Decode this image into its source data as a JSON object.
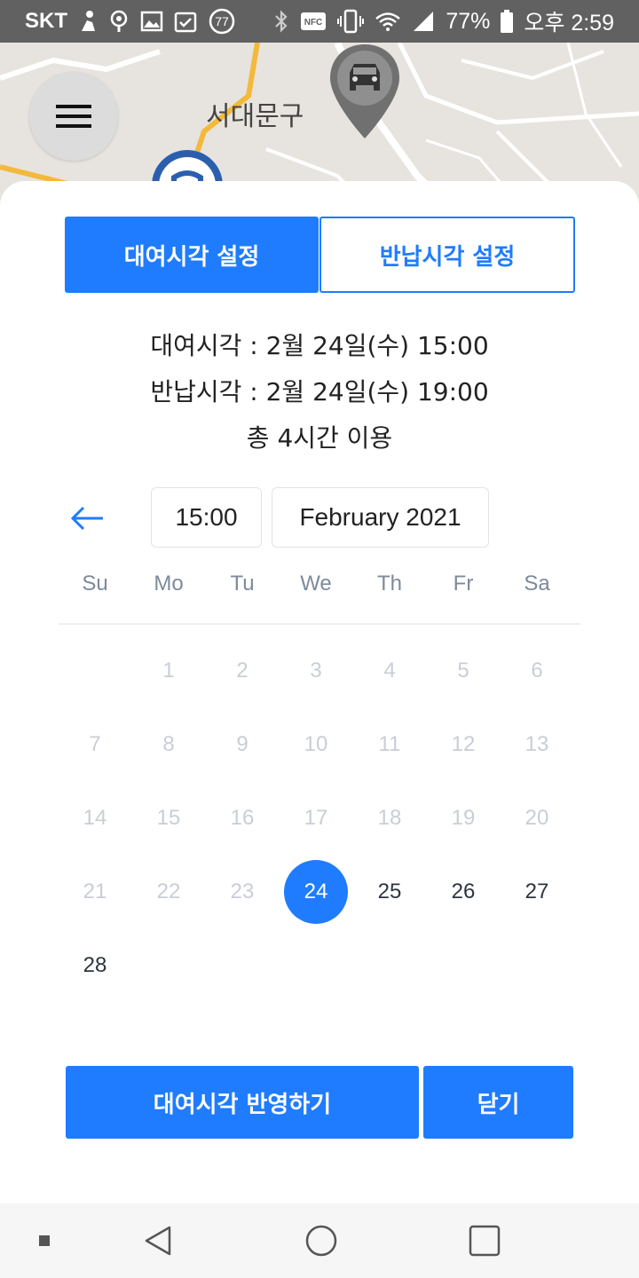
{
  "status_bar": {
    "carrier": "SKT",
    "notification_badge": "77",
    "battery_percent": "77%",
    "time": "오후 2:59",
    "icons": [
      "person-icon",
      "podcast-icon",
      "image-icon",
      "calendar-check-icon",
      "badge-icon",
      "bluetooth-icon",
      "nfc-icon",
      "vibrate-icon",
      "wifi-icon",
      "signal-icon",
      "battery-icon"
    ]
  },
  "map": {
    "district_label": "서대문구",
    "icons": [
      "menu-icon",
      "car-pin-icon",
      "subway-pin-icon"
    ]
  },
  "tabs": {
    "rental": "대여시각 설정",
    "return": "반납시각 설정",
    "active": "rental"
  },
  "summary": {
    "rental_time": "대여시각 : 2월 24일(수) 15:00",
    "return_time": "반납시각 : 2월 24일(수) 19:00",
    "total": "총 4시간 이용"
  },
  "picker": {
    "time": "15:00",
    "month": "February 2021",
    "weekdays": [
      "Su",
      "Mo",
      "Tu",
      "We",
      "Th",
      "Fr",
      "Sa"
    ],
    "days": [
      "1",
      "2",
      "3",
      "4",
      "5",
      "6",
      "7",
      "8",
      "9",
      "10",
      "11",
      "12",
      "13",
      "14",
      "15",
      "16",
      "17",
      "18",
      "19",
      "20",
      "21",
      "22",
      "23",
      "24",
      "25",
      "26",
      "27",
      "28"
    ],
    "selected_day": "24",
    "first_weekday_index": 1,
    "first_enabled_day": 24
  },
  "actions": {
    "apply": "대여시각 반영하기",
    "close": "닫기"
  },
  "colors": {
    "accent": "#1f7cff",
    "disabled_text": "#c9ced6",
    "weekday_text": "#7d8a9c"
  }
}
